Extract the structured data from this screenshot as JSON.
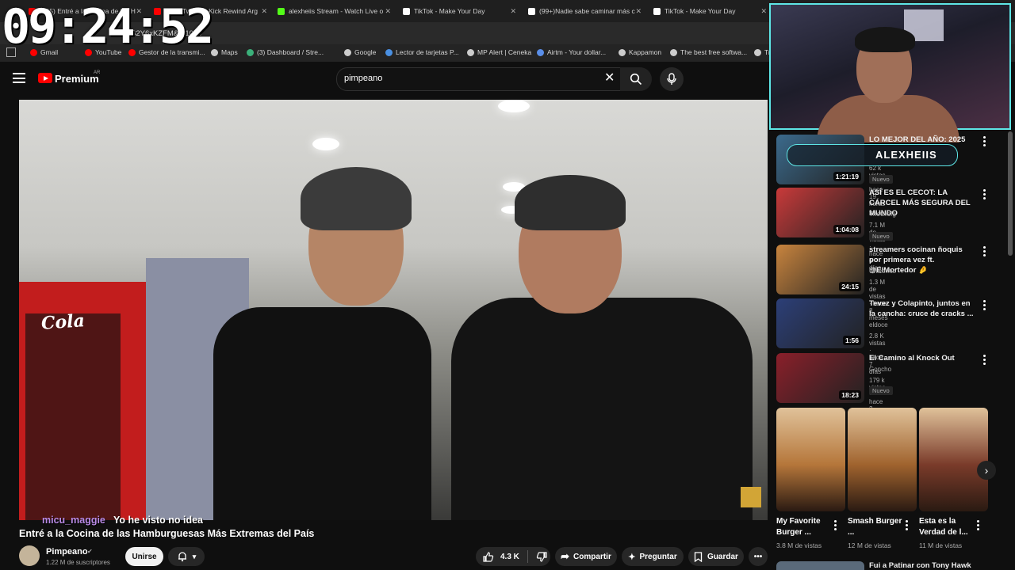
{
  "clock": "09:24:52",
  "browser": {
    "tabs": [
      {
        "title": "(855) Entré a la Cocina de las H",
        "color": "#ff0000"
      },
      {
        "title": "(855) Twitch y Kick Rewind Arg",
        "color": "#ff0000"
      },
      {
        "title": "alexheiis Stream - Watch Live o",
        "color": "#53fc18"
      },
      {
        "title": "TikTok - Make Your Day",
        "color": "#ffffff"
      },
      {
        "title": "(99+)Nadie sabe caminar más c",
        "color": "#ffffff"
      },
      {
        "title": "TikTok - Make Your Day",
        "color": "#ffffff"
      }
    ],
    "address": "B2Y6xKZFM&t=107s",
    "bookmarks": [
      "Gmail",
      "YouTube",
      "Gestor de la transmi...",
      "Maps",
      "(3) Dashboard / Stre...",
      "Google",
      "Lector de tarjetas P...",
      "MP Alert | Ceneka",
      "Airtm - Your dollar...",
      "Kappamon",
      "The best free softwa...",
      "Tr"
    ]
  },
  "header": {
    "logo_text": "Premium",
    "country": "AR",
    "search_value": "pimpeano"
  },
  "player": {
    "fridge_brand": "Coca-Cola"
  },
  "chat_overlay": {
    "user": "micu_maggie",
    "message": "Yo he visto no idea"
  },
  "video": {
    "title": "Entré a la Cocina de las Hamburguesas Más Extremas del País",
    "channel": "Pimpeano",
    "subscribers": "1.22 M de suscriptores",
    "join_label": "Unirse",
    "likes": "4.3 K",
    "share_label": "Compartir",
    "ask_label": "Preguntar",
    "save_label": "Guardar"
  },
  "streamer": {
    "name": "ALEXHEIIS"
  },
  "recommendations": [
    {
      "title": "LO MEJOR DEL AÑO: 2025",
      "channel": "",
      "meta": "62 k vistas · hace 19 horas",
      "duration": "1:21:19",
      "new": "Nuevo",
      "thumb": "#3b6a8c"
    },
    {
      "title": "ASÍ ES EL CECOT: LA CÁRCEL MÁS SEGURA DEL MUNDO",
      "channel": "TheGrefg",
      "meta": "7.1 M de vistas · hace 6 días",
      "duration": "1:04:08",
      "new": "Nuevo",
      "thumb": "#c93a3a"
    },
    {
      "title": "streamers cocinan ñoquis por primera vez ft. @ElMortedor 🤌",
      "channel": "Unicornio",
      "meta": "1.3 M de vistas · hace 8 meses",
      "duration": "24:15",
      "new": "",
      "thumb": "#c8843e"
    },
    {
      "title": "Tevez y Colapinto, juntos en la cancha: cruce de cracks ...",
      "channel": "eldoce",
      "meta": "2.8 K vistas · hace 7 días",
      "duration": "1:56",
      "new": "",
      "thumb": "#2c3f78"
    },
    {
      "title": "El Camino al Knock Out",
      "channel": "Goncho",
      "meta": "179 k vistas · hace 2 días",
      "duration": "18:23",
      "new": "Nuevo",
      "thumb": "#8a1f2a"
    }
  ],
  "shorts": [
    {
      "title": "My Favorite Burger ...",
      "views": "3.8 M de vistas",
      "thumb": "#b5763a"
    },
    {
      "title": "Smash Burger ...",
      "views": "12 M de vistas",
      "thumb": "#a0632e"
    },
    {
      "title": "Esta es la Verdad de l...",
      "views": "11 M de vistas",
      "thumb": "#7a3b2a"
    }
  ],
  "next_video_title": "Fui a Patinar con Tony Hawk"
}
